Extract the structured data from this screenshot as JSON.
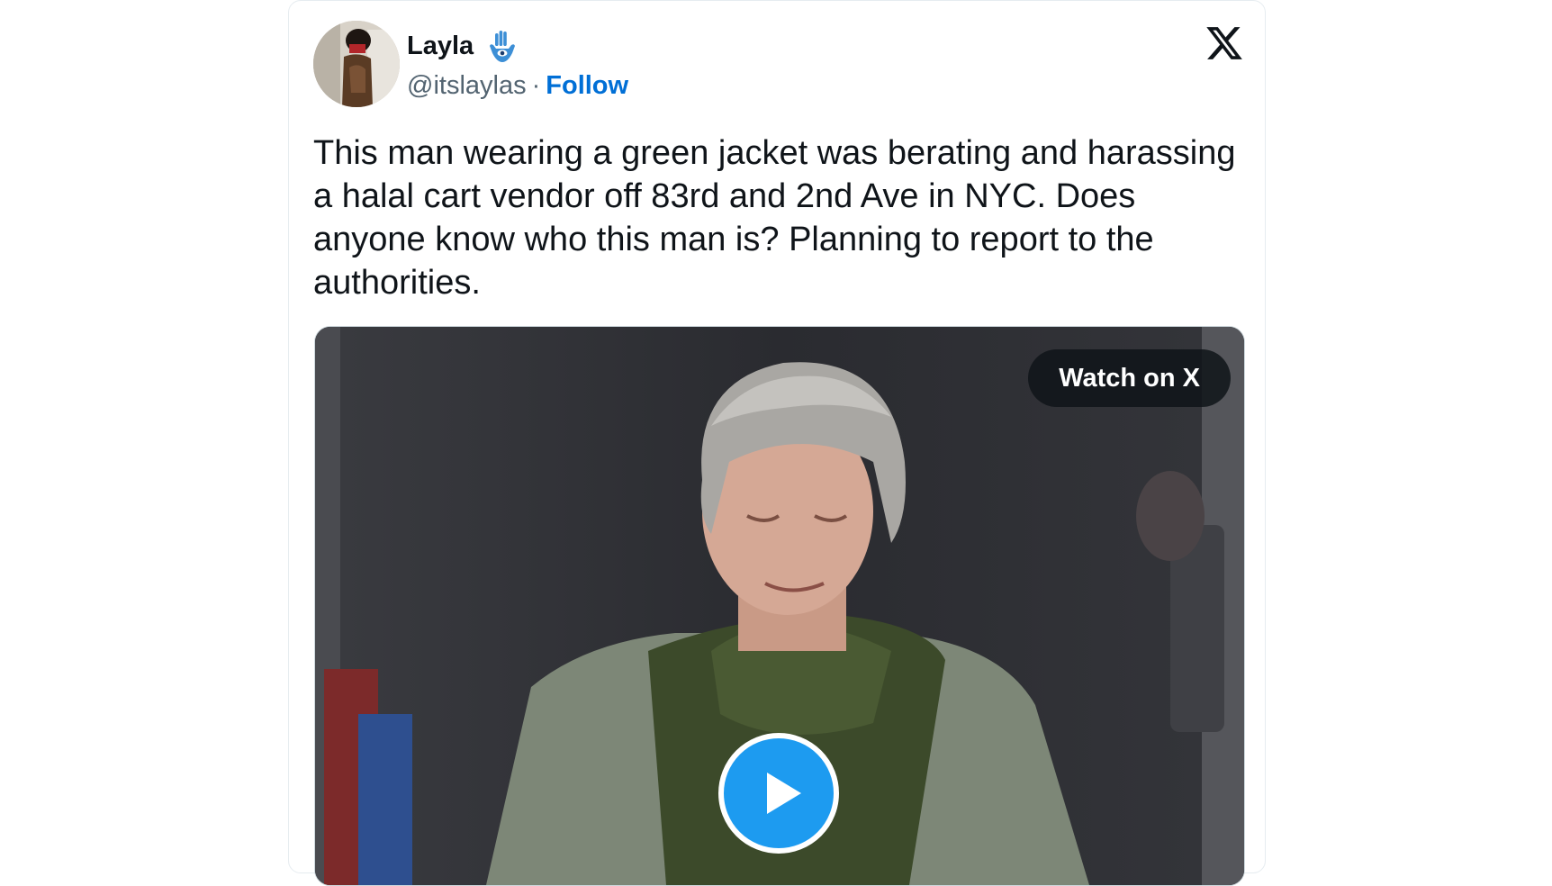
{
  "tweet": {
    "author": {
      "display_name": "Layla",
      "name_emoji": "hamsa-icon",
      "handle": "@itslaylas",
      "separator": "·",
      "follow_label": "Follow"
    },
    "text": "This man wearing a green jacket was berating and harassing a halal cart vendor off 83rd and 2nd Ave in NYC. Does anyone know who this man is? Planning to report to the authorities.",
    "platform_icon": "x-logo-icon",
    "media": {
      "type": "video",
      "watch_label": "Watch on X",
      "play_icon": "play-icon"
    }
  },
  "colors": {
    "text": "#0f1419",
    "handle": "#536471",
    "follow": "#006fd6",
    "play_button": "#1d9bf0"
  }
}
